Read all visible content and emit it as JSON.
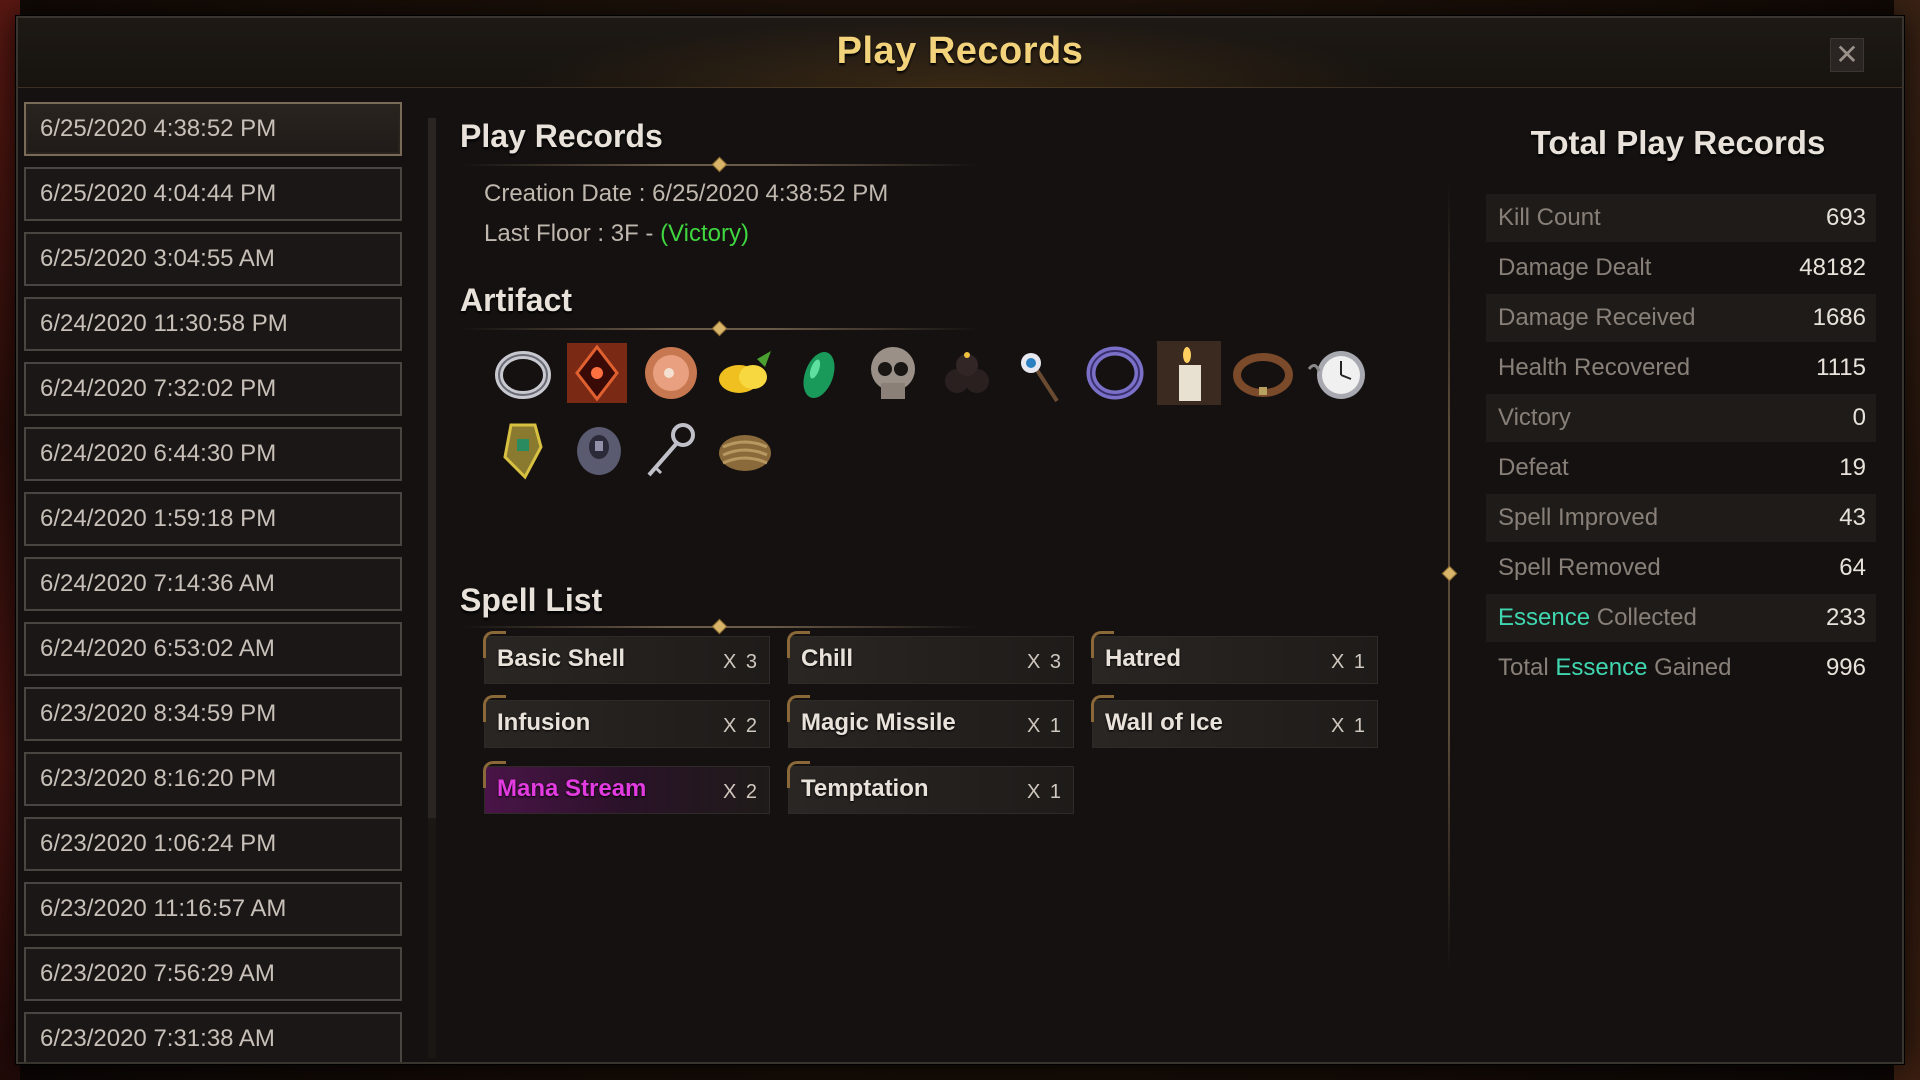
{
  "window": {
    "title": "Play Records",
    "close_label": "✕"
  },
  "records": [
    "6/25/2020 4:38:52 PM",
    "6/25/2020 4:04:44 PM",
    "6/25/2020 3:04:55 AM",
    "6/24/2020 11:30:58 PM",
    "6/24/2020 7:32:02 PM",
    "6/24/2020 6:44:30 PM",
    "6/24/2020 1:59:18 PM",
    "6/24/2020 7:14:36 AM",
    "6/24/2020 6:53:02 AM",
    "6/23/2020 8:34:59 PM",
    "6/23/2020 8:16:20 PM",
    "6/23/2020 1:06:24 PM",
    "6/23/2020 11:16:57 AM",
    "6/23/2020 7:56:29 AM",
    "6/23/2020 7:31:38 AM"
  ],
  "selected_record_index": 0,
  "detail": {
    "section_title": "Play Records",
    "creation_date": "Creation Date : 6/25/2020 4:38:52 PM",
    "last_floor_prefix": "Last Floor : 3F - ",
    "last_floor_result": "(Victory)",
    "artifact_title": "Artifact",
    "spell_title": "Spell List"
  },
  "artifacts": [
    "silver-ring-icon",
    "red-emblem-icon",
    "ham-icon",
    "lemon-icon",
    "green-gem-icon",
    "skull-icon",
    "bombs-icon",
    "eye-staff-icon",
    "purple-ring-icon",
    "candle-icon",
    "leather-collar-icon",
    "pocket-watch-icon",
    "gold-amulet-icon",
    "iron-gauntlet-icon",
    "silver-key-icon",
    "rope-icon"
  ],
  "spells": [
    {
      "name": "Basic Shell",
      "count": "X 3",
      "special": false
    },
    {
      "name": "Chill",
      "count": "X 3",
      "special": false
    },
    {
      "name": "Hatred",
      "count": "X 1",
      "special": false
    },
    {
      "name": "Infusion",
      "count": "X 2",
      "special": false
    },
    {
      "name": "Magic Missile",
      "count": "X 1",
      "special": false
    },
    {
      "name": "Wall of Ice",
      "count": "X 1",
      "special": false
    },
    {
      "name": "Mana Stream",
      "count": "X 2",
      "special": true
    },
    {
      "name": "Temptation",
      "count": "X 1",
      "special": false
    }
  ],
  "stats": {
    "title": "Total Play Records",
    "rows": [
      {
        "label": "Kill Count",
        "value": "693"
      },
      {
        "label": "Damage Dealt",
        "value": "48182"
      },
      {
        "label": "Damage Received",
        "value": "1686"
      },
      {
        "label": "Health Recovered",
        "value": "1115"
      },
      {
        "label": "Victory",
        "value": "0"
      },
      {
        "label": "Defeat",
        "value": "19"
      },
      {
        "label": "Spell Improved",
        "value": "43"
      },
      {
        "label": "Spell Removed",
        "value": "64"
      },
      {
        "label_highlight": "Essence",
        "label_rest": " Collected",
        "value": "233"
      },
      {
        "label_prefix": "Total ",
        "label_highlight": "Essence",
        "label_rest": " Gained",
        "value": "996"
      }
    ]
  },
  "colors": {
    "title": "#f2d27a",
    "victory": "#3fd63f",
    "essence": "#3fd6b0",
    "magic_spell": "#e23be0"
  }
}
